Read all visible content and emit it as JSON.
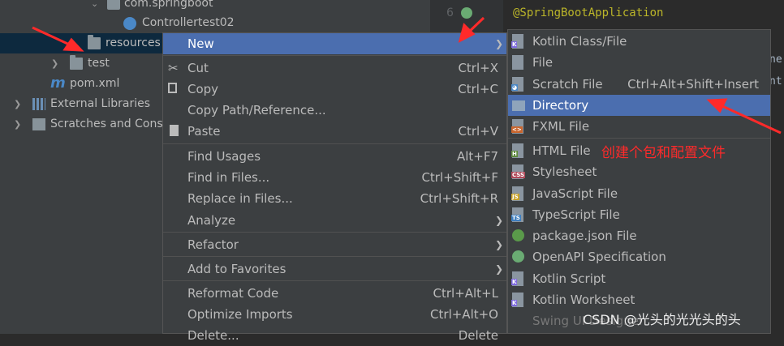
{
  "project_tree": {
    "rows": [
      {
        "label": "com.springboot"
      },
      {
        "label": "Controllertest02"
      },
      {
        "label": "resources"
      },
      {
        "label": "test"
      },
      {
        "label": "pom.xml"
      },
      {
        "label": "External Libraries"
      },
      {
        "label": "Scratches and Cons"
      }
    ]
  },
  "editor": {
    "line_number": "6",
    "code": "@SpringBootApplication",
    "edge_fragments": [
      "ne",
      "nt"
    ]
  },
  "context_menu": {
    "items": [
      {
        "label": "New",
        "shortcut": "",
        "submenu": true
      },
      {
        "label": "Cut",
        "shortcut": "Ctrl+X"
      },
      {
        "label": "Copy",
        "shortcut": "Ctrl+C"
      },
      {
        "label": "Copy Path/Reference...",
        "shortcut": ""
      },
      {
        "label": "Paste",
        "shortcut": "Ctrl+V"
      },
      {
        "label": "Find Usages",
        "shortcut": "Alt+F7"
      },
      {
        "label": "Find in Files...",
        "shortcut": "Ctrl+Shift+F"
      },
      {
        "label": "Replace in Files...",
        "shortcut": "Ctrl+Shift+R"
      },
      {
        "label": "Analyze",
        "shortcut": "",
        "submenu": true
      },
      {
        "label": "Refactor",
        "shortcut": "",
        "submenu": true
      },
      {
        "label": "Add to Favorites",
        "shortcut": "",
        "submenu": true
      },
      {
        "label": "Reformat Code",
        "shortcut": "Ctrl+Alt+L"
      },
      {
        "label": "Optimize Imports",
        "shortcut": "Ctrl+Alt+O"
      },
      {
        "label": "Delete...",
        "shortcut": "Delete"
      }
    ]
  },
  "new_submenu": {
    "items": [
      {
        "label": "Kotlin Class/File",
        "shortcut": ""
      },
      {
        "label": "File",
        "shortcut": ""
      },
      {
        "label": "Scratch File",
        "shortcut": "Ctrl+Alt+Shift+Insert"
      },
      {
        "label": "Directory",
        "shortcut": ""
      },
      {
        "label": "FXML File",
        "shortcut": ""
      },
      {
        "label": "HTML File",
        "shortcut": ""
      },
      {
        "label": "Stylesheet",
        "shortcut": ""
      },
      {
        "label": "JavaScript File",
        "shortcut": ""
      },
      {
        "label": "TypeScript File",
        "shortcut": ""
      },
      {
        "label": "package.json File",
        "shortcut": ""
      },
      {
        "label": "OpenAPI Specification",
        "shortcut": ""
      },
      {
        "label": "Kotlin Script",
        "shortcut": ""
      },
      {
        "label": "Kotlin Worksheet",
        "shortcut": ""
      },
      {
        "label": "Swing UI Designer",
        "shortcut": ""
      }
    ]
  },
  "annotation": "创建个包和配置文件",
  "watermark": "CSDN @光头的光光头的头",
  "colors": {
    "menu_bg": "#3c3f41",
    "highlight": "#4b6eaf",
    "annotation_red": "#ff2a2a",
    "annotation_font_weight": "normal"
  },
  "icons": {
    "cut": "scissors-icon",
    "copy": "copy-icon",
    "paste": "paste-icon",
    "folder": "folder-icon",
    "library": "library-icon",
    "maven": "maven-m-icon"
  }
}
